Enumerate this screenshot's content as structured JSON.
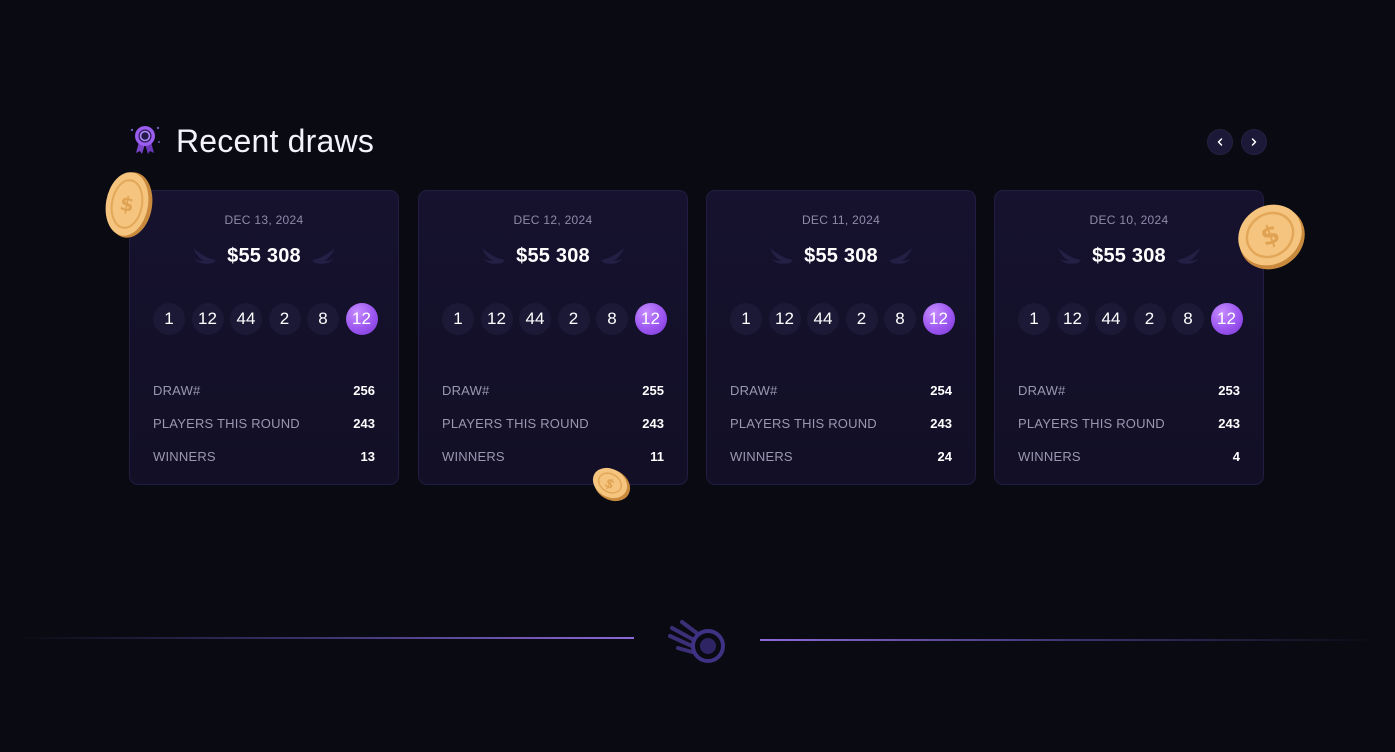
{
  "header": {
    "title": "Recent draws",
    "icon": "award-ribbon-icon",
    "prev_icon": "chevron-left-icon",
    "next_icon": "chevron-right-icon"
  },
  "labels": {
    "draw": "DRAW#",
    "players": "PLAYERS THIS ROUND",
    "winners": "WINNERS"
  },
  "draws": [
    {
      "date": "DEC 13, 2024",
      "prize": "$55 308",
      "numbers": [
        "1",
        "12",
        "44",
        "2",
        "8"
      ],
      "bonus": "12",
      "draw": "256",
      "players": "243",
      "winners": "13"
    },
    {
      "date": "DEC 12, 2024",
      "prize": "$55 308",
      "numbers": [
        "1",
        "12",
        "44",
        "2",
        "8"
      ],
      "bonus": "12",
      "draw": "255",
      "players": "243",
      "winners": "11"
    },
    {
      "date": "DEC 11, 2024",
      "prize": "$55 308",
      "numbers": [
        "1",
        "12",
        "44",
        "2",
        "8"
      ],
      "bonus": "12",
      "draw": "254",
      "players": "243",
      "winners": "24"
    },
    {
      "date": "DEC 10, 2024",
      "prize": "$55 308",
      "numbers": [
        "1",
        "12",
        "44",
        "2",
        "8"
      ],
      "bonus": "12",
      "draw": "253",
      "players": "243",
      "winners": "4"
    }
  ],
  "colors": {
    "background": "#0a0a12",
    "card": "#16122f",
    "ball": "#1b1936",
    "bonus_ball": "#9b55f0",
    "accent": "#8c6ad8",
    "coin": "#f2c27a"
  },
  "footer": {
    "logo_icon": "comet-logo-icon"
  }
}
